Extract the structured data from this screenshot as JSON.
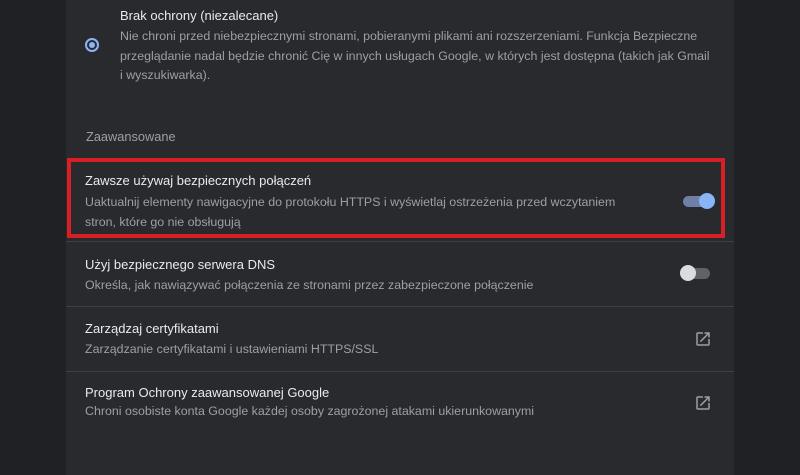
{
  "protection": {
    "title": "Brak ochrony (niezalecane)",
    "description": "Nie chroni przed niebezpiecznymi stronami, pobieranymi plikami ani rozszerzeniami. Funkcja Bezpieczne przeglądanie nadal będzie chronić Cię w innych usługach Google, w których jest dostępna (takich jak Gmail i wyszukiwarka).",
    "selected": true
  },
  "advanced": {
    "header": "Zaawansowane",
    "https": {
      "title": "Zawsze używaj bezpiecznych połączeń",
      "description": "Uaktualnij elementy nawigacyjne do protokołu HTTPS i wyświetlaj ostrzeżenia przed wczytaniem stron, które go nie obsługują",
      "enabled": true
    },
    "dns": {
      "title": "Użyj bezpiecznego serwera DNS",
      "description": "Określa, jak nawiązywać połączenia ze stronami przez zabezpieczone połączenie",
      "enabled": false
    },
    "certificates": {
      "title": "Zarządzaj certyfikatami",
      "description": "Zarządzanie certyfikatami i ustawieniami HTTPS/SSL",
      "icon": "open-in-new-icon"
    },
    "advanced_protection": {
      "title": "Program Ochrony zaawansowanej Google",
      "description": "Chroni osobiste konta Google każdej osoby zagrożonej atakami ukierunkowanymi",
      "icon": "open-in-new-icon"
    }
  },
  "colors": {
    "accent": "#8ab4f8",
    "highlight": "#d81f26"
  }
}
